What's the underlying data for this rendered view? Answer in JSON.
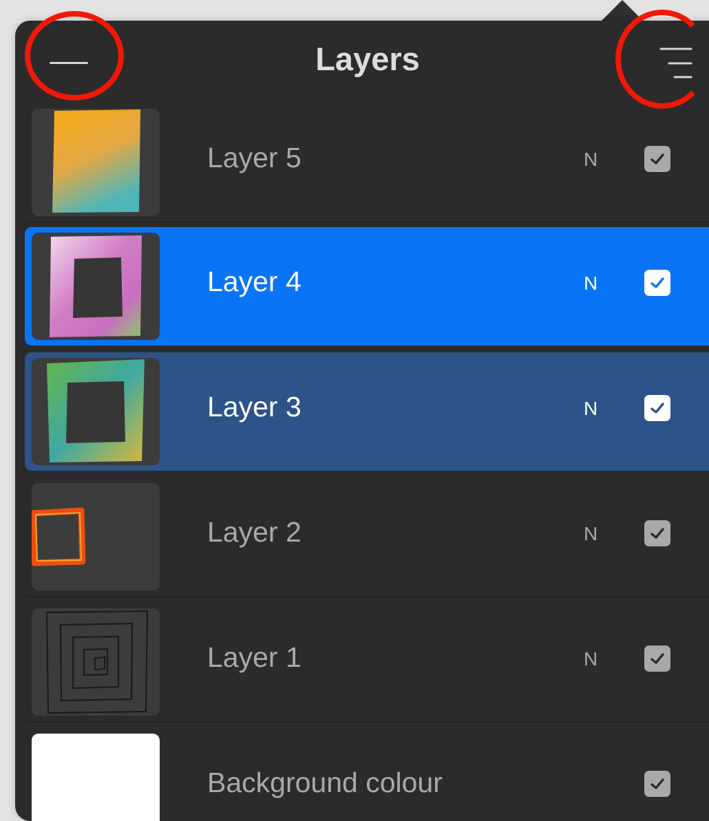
{
  "header": {
    "title": "Layers",
    "collapse_icon": "minus-icon",
    "menu_icon": "menu-lines-icon"
  },
  "annotation_color": "#f01808",
  "colors": {
    "panel_bg": "#2b2b2b",
    "primary_selection": "#0a74f7",
    "secondary_selection": "#2c5488",
    "inactive_text": "#a9a9a9",
    "active_text": "#ffffff"
  },
  "layers": [
    {
      "name": "Layer 5",
      "blend_mode": "N",
      "visible": true,
      "selected": false
    },
    {
      "name": "Layer 4",
      "blend_mode": "N",
      "visible": true,
      "selected": "primary"
    },
    {
      "name": "Layer 3",
      "blend_mode": "N",
      "visible": true,
      "selected": "secondary"
    },
    {
      "name": "Layer 2",
      "blend_mode": "N",
      "visible": true,
      "selected": false
    },
    {
      "name": "Layer 1",
      "blend_mode": "N",
      "visible": true,
      "selected": false
    }
  ],
  "background": {
    "name": "Background colour",
    "color": "#ffffff",
    "visible": true
  }
}
